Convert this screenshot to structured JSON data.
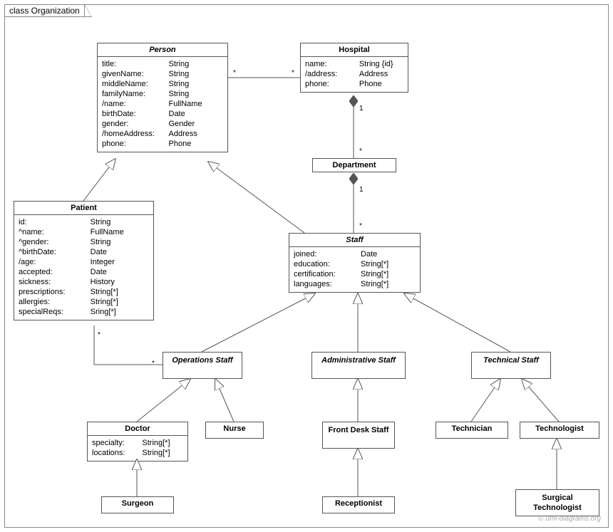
{
  "frame": {
    "label": "class Organization"
  },
  "watermark": "© uml-diagrams.org",
  "classes": {
    "person": {
      "name": "Person",
      "abstract": true,
      "attributes": [
        [
          "title:",
          "String"
        ],
        [
          "givenName:",
          "String"
        ],
        [
          "middleName:",
          "String"
        ],
        [
          "familyName:",
          "String"
        ],
        [
          "/name:",
          "FullName"
        ],
        [
          "birthDate:",
          "Date"
        ],
        [
          "gender:",
          "Gender"
        ],
        [
          "/homeAddress:",
          "Address"
        ],
        [
          "phone:",
          "Phone"
        ]
      ]
    },
    "hospital": {
      "name": "Hospital",
      "attributes": [
        [
          "name:",
          "String {id}"
        ],
        [
          "/address:",
          "Address"
        ],
        [
          "phone:",
          "Phone"
        ]
      ]
    },
    "department": {
      "name": "Department"
    },
    "staff": {
      "name": "Staff",
      "abstract": true,
      "attributes": [
        [
          "joined:",
          "Date"
        ],
        [
          "education:",
          "String[*]"
        ],
        [
          "certification:",
          "String[*]"
        ],
        [
          "languages:",
          "String[*]"
        ]
      ]
    },
    "patient": {
      "name": "Patient",
      "attributes": [
        [
          "id:",
          "String"
        ],
        [
          "^name:",
          "FullName"
        ],
        [
          "^gender:",
          "String"
        ],
        [
          "^birthDate:",
          "Date"
        ],
        [
          "/age:",
          "Integer"
        ],
        [
          "accepted:",
          "Date"
        ],
        [
          "sickness:",
          "History"
        ],
        [
          "prescriptions:",
          "String[*]"
        ],
        [
          "allergies:",
          "String[*]"
        ],
        [
          "specialReqs:",
          "Sring[*]"
        ]
      ]
    },
    "opstaff": {
      "name": "Operations Staff",
      "abstract": true
    },
    "admstaff": {
      "name": "Administrative Staff",
      "abstract": true
    },
    "techstaff": {
      "name": "Technical Staff",
      "abstract": true
    },
    "doctor": {
      "name": "Doctor",
      "attributes": [
        [
          "specialty:",
          "String[*]"
        ],
        [
          "locations:",
          "String[*]"
        ]
      ]
    },
    "nurse": {
      "name": "Nurse"
    },
    "frontdesk": {
      "name": "Front Desk Staff"
    },
    "technician": {
      "name": "Technician"
    },
    "technologist": {
      "name": "Technologist"
    },
    "surgeon": {
      "name": "Surgeon"
    },
    "receptionist": {
      "name": "Receptionist"
    },
    "surgtech": {
      "name": "Surgical Technologist"
    }
  },
  "mults": {
    "person_hospital_left": "*",
    "person_hospital_right": "*",
    "hosp_dept_top": "1",
    "hosp_dept_bot": "*",
    "dept_staff_top": "1",
    "dept_staff_bot": "*",
    "patient_ops_top": "*",
    "patient_ops_bot": "*"
  }
}
